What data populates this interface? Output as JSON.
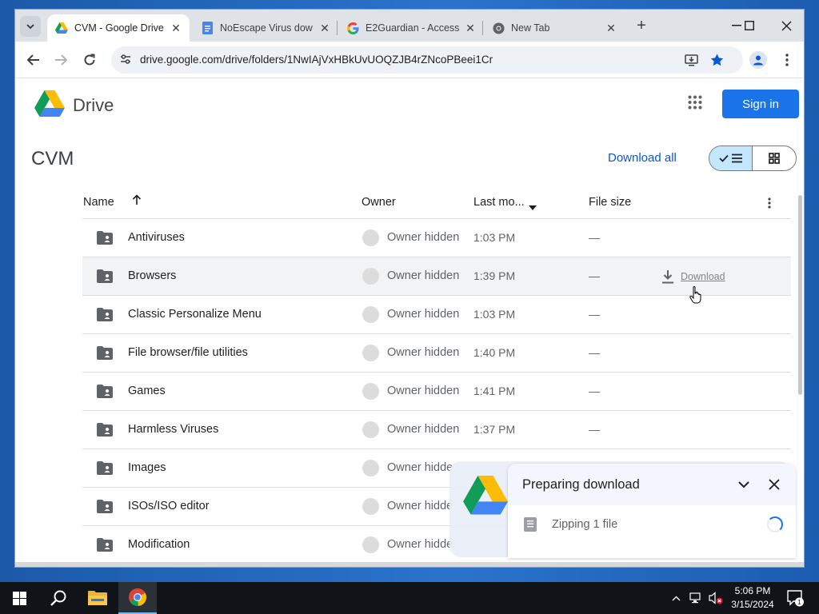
{
  "browser": {
    "tabs": [
      {
        "title": "CVM - Google Drive",
        "icon": "google-drive-icon",
        "active": true
      },
      {
        "title": "NoEscape Virus dow",
        "icon": "google-docs-icon",
        "active": false
      },
      {
        "title": "E2Guardian - Access",
        "icon": "google-g-icon",
        "active": false
      },
      {
        "title": "New Tab",
        "icon": "chrome-icon",
        "active": false
      }
    ],
    "url": "drive.google.com/drive/folders/1NwIAjVxHBkUvUOQZJB4rZNcoPBeei1Cr"
  },
  "drive": {
    "brand": "Drive",
    "sign_in": "Sign in",
    "folder_title": "CVM",
    "download_all": "Download all",
    "columns": {
      "name": "Name",
      "owner": "Owner",
      "modified": "Last mo...",
      "size": "File size"
    },
    "rows": [
      {
        "name": "Antiviruses",
        "owner": "Owner hidden",
        "modified": "1:03 PM",
        "size": "—"
      },
      {
        "name": "Browsers",
        "owner": "Owner hidden",
        "modified": "1:39 PM",
        "size": "—",
        "hover_action": "Download"
      },
      {
        "name": "Classic Personalize Menu",
        "owner": "Owner hidden",
        "modified": "1:03 PM",
        "size": "—"
      },
      {
        "name": "File browser/file utilities",
        "owner": "Owner hidden",
        "modified": "1:40 PM",
        "size": "—"
      },
      {
        "name": "Games",
        "owner": "Owner hidden",
        "modified": "1:41 PM",
        "size": "—"
      },
      {
        "name": "Harmless Viruses",
        "owner": "Owner hidden",
        "modified": "1:37 PM",
        "size": "—"
      },
      {
        "name": "Images",
        "owner": "Owner hidde",
        "modified": "",
        "size": ""
      },
      {
        "name": "ISOs/ISO editor",
        "owner": "Owner hidde",
        "modified": "",
        "size": ""
      },
      {
        "name": "Modification",
        "owner": "Owner hidde",
        "modified": "",
        "size": ""
      }
    ],
    "download_panel": {
      "title": "Preparing download",
      "status": "Zipping 1 file"
    }
  },
  "taskbar": {
    "time": "5:06 PM",
    "date": "3/15/2024",
    "notifications": "1"
  },
  "colors": {
    "accent": "#1a73e8",
    "link": "#0b57d0",
    "toggle_on": "#c2e7ff",
    "desktop": "#1f5fb4"
  }
}
